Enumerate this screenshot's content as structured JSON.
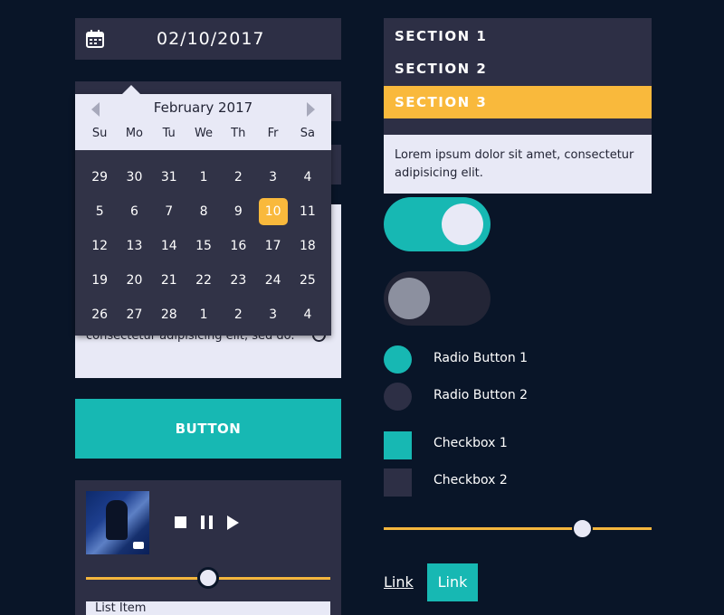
{
  "colors": {
    "background": "#091528",
    "panel": "#2d2f45",
    "teal": "#17b8b3",
    "yellow": "#f9b93c",
    "light": "#e8e9f6"
  },
  "date_picker": {
    "value": "02/10/2017",
    "icon": "calendar-icon",
    "month_label": "February 2017",
    "weekdays": [
      "Su",
      "Mo",
      "Tu",
      "We",
      "Th",
      "Fr",
      "Sa"
    ],
    "days": [
      "29",
      "30",
      "31",
      "1",
      "2",
      "3",
      "4",
      "5",
      "6",
      "7",
      "8",
      "9",
      "10",
      "11",
      "12",
      "13",
      "14",
      "15",
      "16",
      "17",
      "18",
      "19",
      "20",
      "21",
      "22",
      "23",
      "24",
      "25",
      "26",
      "27",
      "28",
      "1",
      "2",
      "3",
      "4"
    ],
    "selected_day": "10"
  },
  "card": {
    "text": "consectetur adipisicing elit, sed do."
  },
  "button": {
    "label": "BUTTON"
  },
  "player": {
    "progress": 0.5,
    "list_item": "List Item"
  },
  "accordion": {
    "sections": [
      "SECTION 1",
      "SECTION 2",
      "SECTION 3"
    ],
    "active_index": 2,
    "body": "Lorem ipsum dolor sit amet, consectetur adipisicing elit."
  },
  "toggles": [
    {
      "state": "on"
    },
    {
      "state": "off"
    }
  ],
  "radios": [
    {
      "label": "Radio Button 1",
      "checked": true
    },
    {
      "label": "Radio Button 2",
      "checked": false
    }
  ],
  "checkboxes": [
    {
      "label": "Checkbox 1",
      "checked": true
    },
    {
      "label": "Checkbox 2",
      "checked": false
    }
  ],
  "slider": {
    "value": 0.74
  },
  "links": {
    "plain": "Link",
    "button": "Link"
  }
}
